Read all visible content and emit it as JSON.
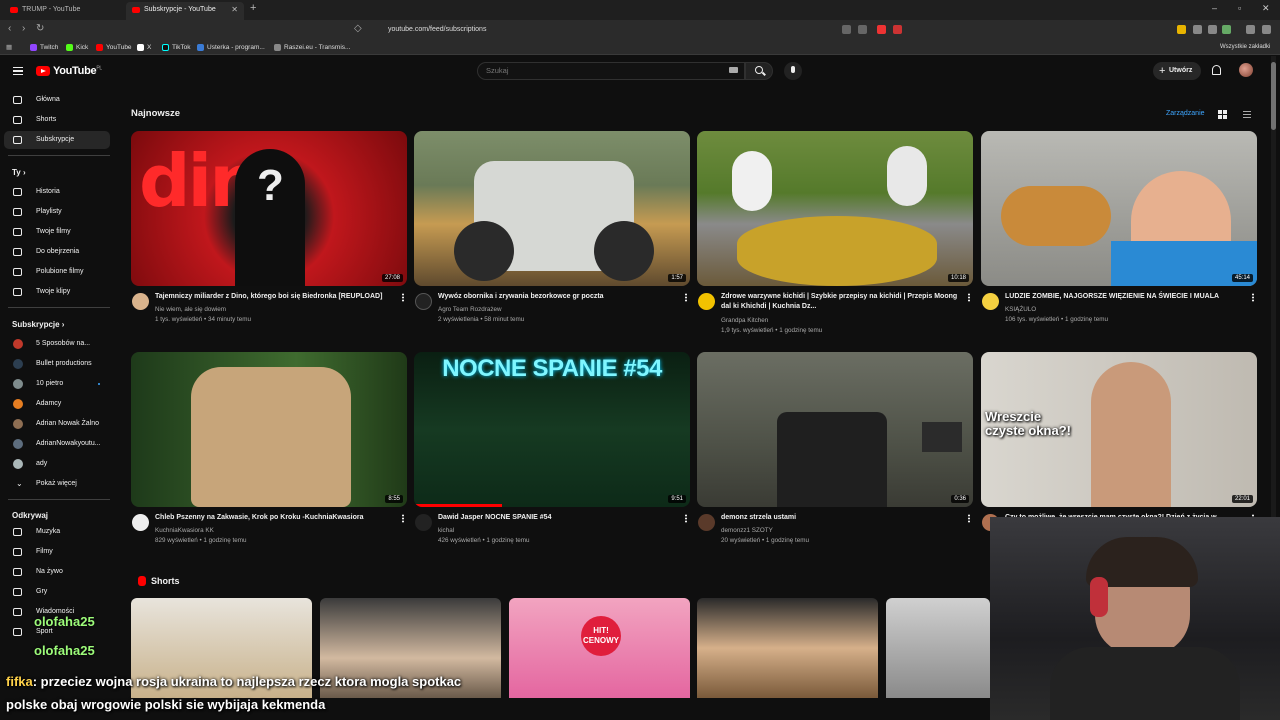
{
  "browser": {
    "tabs": [
      {
        "label": "TRUMP - YouTube",
        "active": false
      },
      {
        "label": "Subskrypcje - YouTube",
        "active": true
      }
    ],
    "url": "youtube.com/feed/subscriptions",
    "bookmarks": [
      "Twitch",
      "Kick",
      "YouTube",
      "X",
      "TikTok",
      "Usterka - program...",
      "Raszei.eu - Transmis..."
    ],
    "all_bookmarks": "Wszystkie zakładki"
  },
  "header": {
    "logo": "YouTube",
    "logo_region": "PL",
    "search_placeholder": "Szukaj",
    "create_label": "Utwórz"
  },
  "sidebar": {
    "main": [
      {
        "label": "Główna",
        "icon": "home-icon"
      },
      {
        "label": "Shorts",
        "icon": "shorts-icon"
      },
      {
        "label": "Subskrypcje",
        "icon": "subscriptions-icon",
        "active": true
      }
    ],
    "you_header": "Ty",
    "you": [
      {
        "label": "Historia",
        "icon": "history-icon"
      },
      {
        "label": "Playlisty",
        "icon": "playlists-icon"
      },
      {
        "label": "Twoje filmy",
        "icon": "your-videos-icon"
      },
      {
        "label": "Do obejrzenia",
        "icon": "watch-later-icon"
      },
      {
        "label": "Polubione filmy",
        "icon": "liked-icon"
      },
      {
        "label": "Twoje klipy",
        "icon": "clips-icon"
      }
    ],
    "subs_header": "Subskrypcje",
    "subs": [
      {
        "label": "5 Sposobów na...",
        "color": "#c0392b",
        "dot": false
      },
      {
        "label": "Bullet productions",
        "color": "#2c3e50",
        "dot": false
      },
      {
        "label": "10 pietro",
        "color": "#7f8c8d",
        "dot": true
      },
      {
        "label": "Adamcy",
        "color": "#e67e22",
        "dot": false
      },
      {
        "label": "Adrian Nowak Żalno",
        "color": "#8e6e53",
        "dot": false
      },
      {
        "label": "AdrianNowakyoutu...",
        "color": "#5d6d7e",
        "dot": false
      },
      {
        "label": "ady",
        "color": "#aab7b8",
        "dot": false
      }
    ],
    "show_more": "Pokaż więcej",
    "explore_header": "Odkrywaj",
    "explore": [
      {
        "label": "Muzyka",
        "icon": "music-icon"
      },
      {
        "label": "Filmy",
        "icon": "movies-icon"
      },
      {
        "label": "Na żywo",
        "icon": "live-icon"
      },
      {
        "label": "Gry",
        "icon": "gaming-icon"
      },
      {
        "label": "Wiadomości",
        "icon": "news-icon"
      },
      {
        "label": "Sport",
        "icon": "sport-icon"
      }
    ]
  },
  "main": {
    "section_title": "Najnowsze",
    "manage_label": "Zarządzanie",
    "videos": [
      {
        "title": "Tajemniczy miliarder z Dino, którego boi się Biedronka [REUPLOAD]",
        "channel": "Nie wiem, ale się dowiem",
        "meta": "1 tys. wyświetleń • 34 minuty temu",
        "duration": "27:08",
        "thumb_text": "dino"
      },
      {
        "title": "Wywóz obornika i zrywania bezorkowce gr poczta",
        "channel": "Agro Team Rozdrażew",
        "meta": "2 wyświetlenia • 58 minut temu",
        "duration": "1:57",
        "thumb_text": ""
      },
      {
        "title": "Zdrowe warzywne kichidi | Szybkie przepisy na kichidi | Przepis Moong dal ki Khichdi | Kuchnia Dz...",
        "channel": "Grandpa Kitchen",
        "meta": "1,9 tys. wyświetleń • 1 godzinę temu",
        "duration": "10:18",
        "thumb_text": ""
      },
      {
        "title": "LUDZIE ZOMBIE, NAJGORSZE WIĘZIENIE NA ŚWIECIE I MUALA",
        "channel": "KSIĄŻULO",
        "meta": "106 tys. wyświetleń • 1 godzinę temu",
        "duration": "45:14",
        "thumb_text": ""
      },
      {
        "title": "Chleb Pszenny na Zakwasie, Krok po Kroku -KuchniaKwasiora",
        "channel": "KuchniaKwasiora KK",
        "meta": "829 wyświetleń • 1 godzinę temu",
        "duration": "8:55",
        "thumb_text": ""
      },
      {
        "title": "Dawid Jasper NOCNE SPANIE #54",
        "channel": "kichal",
        "meta": "426 wyświetleń • 1 godzinę temu",
        "duration": "9:51",
        "thumb_text": "NOCNE SPANIE #54"
      },
      {
        "title": "demonz strzela ustami",
        "channel": "demonzz1 SZOTY",
        "meta": "20 wyświetleń • 1 godzinę temu",
        "duration": "0:36",
        "thumb_text": ""
      },
      {
        "title": "Czy to możliwe, że wreszcie mam czyste okna?! Dzień z życia w...",
        "channel": "",
        "meta": "",
        "duration": "22:01",
        "thumb_text": "Wreszcie czyste okna?!"
      }
    ],
    "shorts_title": "Shorts",
    "shorts_badge": "HIT! CENOWY"
  },
  "overlay": {
    "chat_user": "fifka",
    "chat_text": ": przeciez wojna rosja ukraina to najlepsza rzecz ktora mogla spotkac",
    "chat_text2": "polske obaj wrogowie polski sie wybijaja kekmenda",
    "chat_small1": "olofaha25",
    "chat_small2": "olofaha25"
  }
}
